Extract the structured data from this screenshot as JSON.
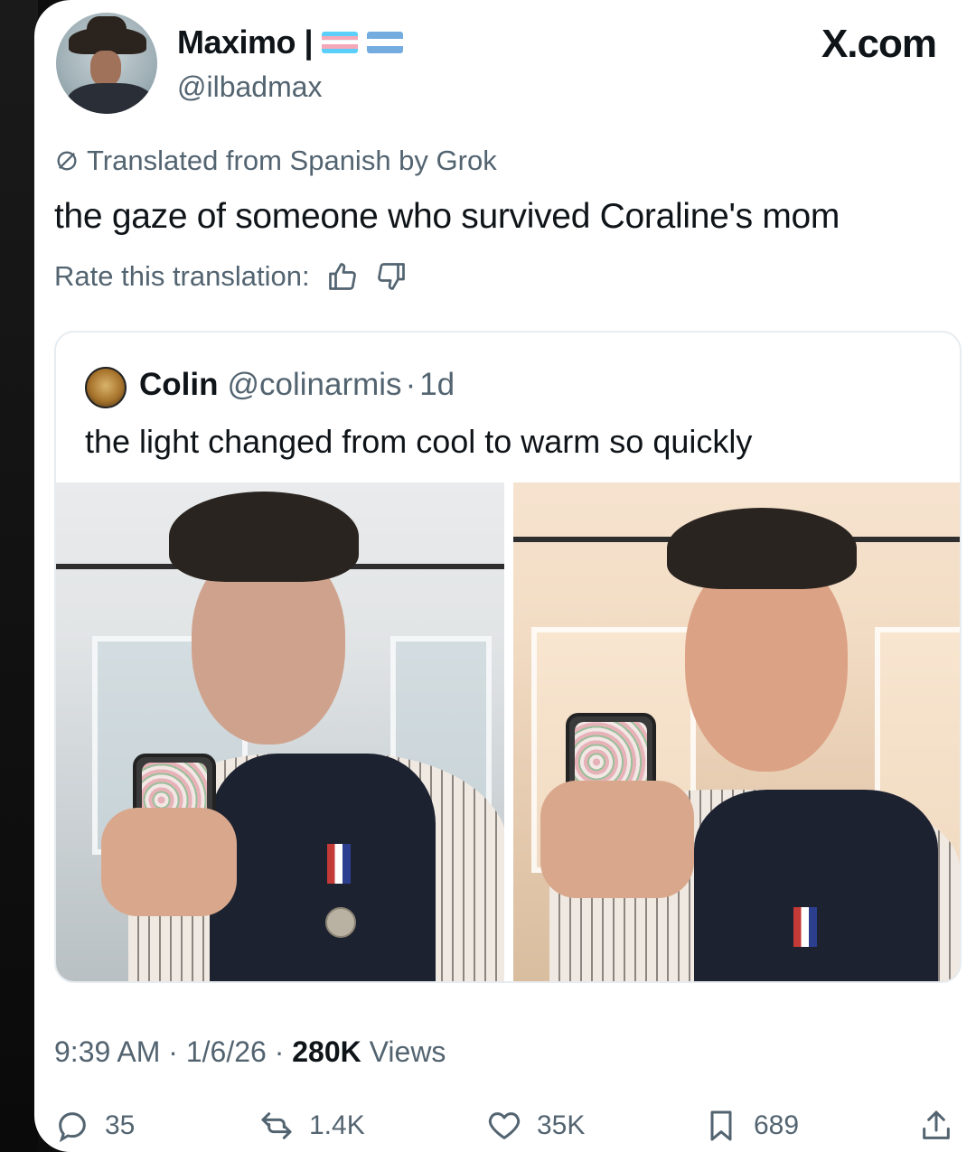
{
  "post": {
    "author_name": "Maximo |",
    "handle": "@ilbadmax",
    "site": "X.com",
    "flags": [
      {
        "name": "transgender-flag",
        "colors": [
          "#5bcefa",
          "#f5a9b8",
          "#ffffff",
          "#f5a9b8",
          "#5bcefa"
        ]
      },
      {
        "name": "argentina-flag",
        "colors": [
          "#74acdf",
          "#ffffff",
          "#74acdf"
        ]
      }
    ],
    "translated_label": "Translated from Spanish by Grok",
    "text": "the gaze of someone who survived Coraline's mom",
    "rate_label": "Rate this translation:",
    "time": "9:39 AM",
    "date": "1/6/26",
    "views_count": "280K",
    "views_label": "Views",
    "separator": "·"
  },
  "quote": {
    "name": "Colin",
    "handle": "@colinarmis",
    "age": "1d",
    "text": "the light changed from cool to warm so quickly"
  },
  "actions": {
    "replies": "35",
    "reposts": "1.4K",
    "likes": "35K",
    "bookmarks": "689"
  },
  "icons": {
    "translate": "translate-icon",
    "thumbs_up": "thumbs-up-icon",
    "thumbs_down": "thumbs-down-icon",
    "reply": "reply-icon",
    "repost": "repost-icon",
    "like": "heart-icon",
    "bookmark": "bookmark-icon",
    "share": "share-icon"
  },
  "colors": {
    "text_primary": "#0f1419",
    "text_secondary": "#536471",
    "border": "#e6ecf0",
    "background": "#ffffff"
  }
}
